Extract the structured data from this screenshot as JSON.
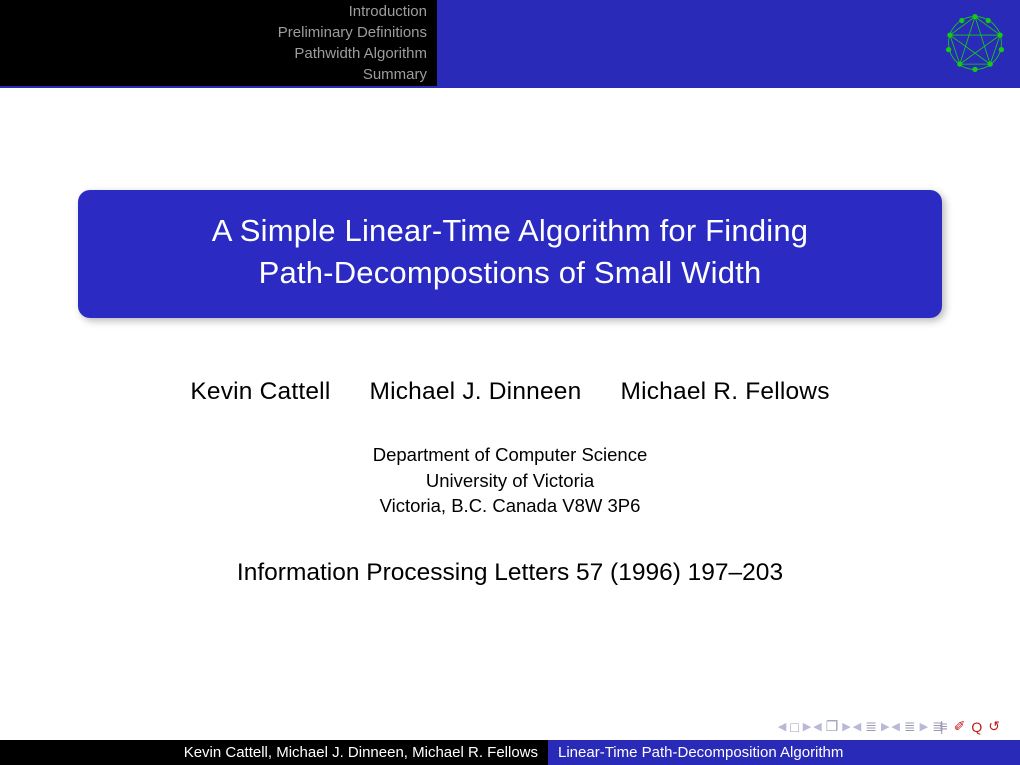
{
  "header": {
    "sections": [
      "Introduction",
      "Preliminary Definitions",
      "Pathwidth Algorithm",
      "Summary"
    ]
  },
  "title": {
    "line1": "A Simple Linear-Time Algorithm for Finding",
    "line2": "Path-Decompostions of Small Width"
  },
  "authors": [
    "Kevin Cattell",
    "Michael J. Dinneen",
    "Michael R. Fellows"
  ],
  "affiliation": {
    "line1": "Department of Computer Science",
    "line2": "University of Victoria",
    "line3": "Victoria, B.C. Canada  V8W 3P6"
  },
  "journal": "Information Processing Letters 57 (1996) 197–203",
  "footer": {
    "left": "Kevin Cattell, Michael J. Dinneen, Michael R. Fellows",
    "right": "Linear-Time Path-Decomposition Algorithm"
  }
}
